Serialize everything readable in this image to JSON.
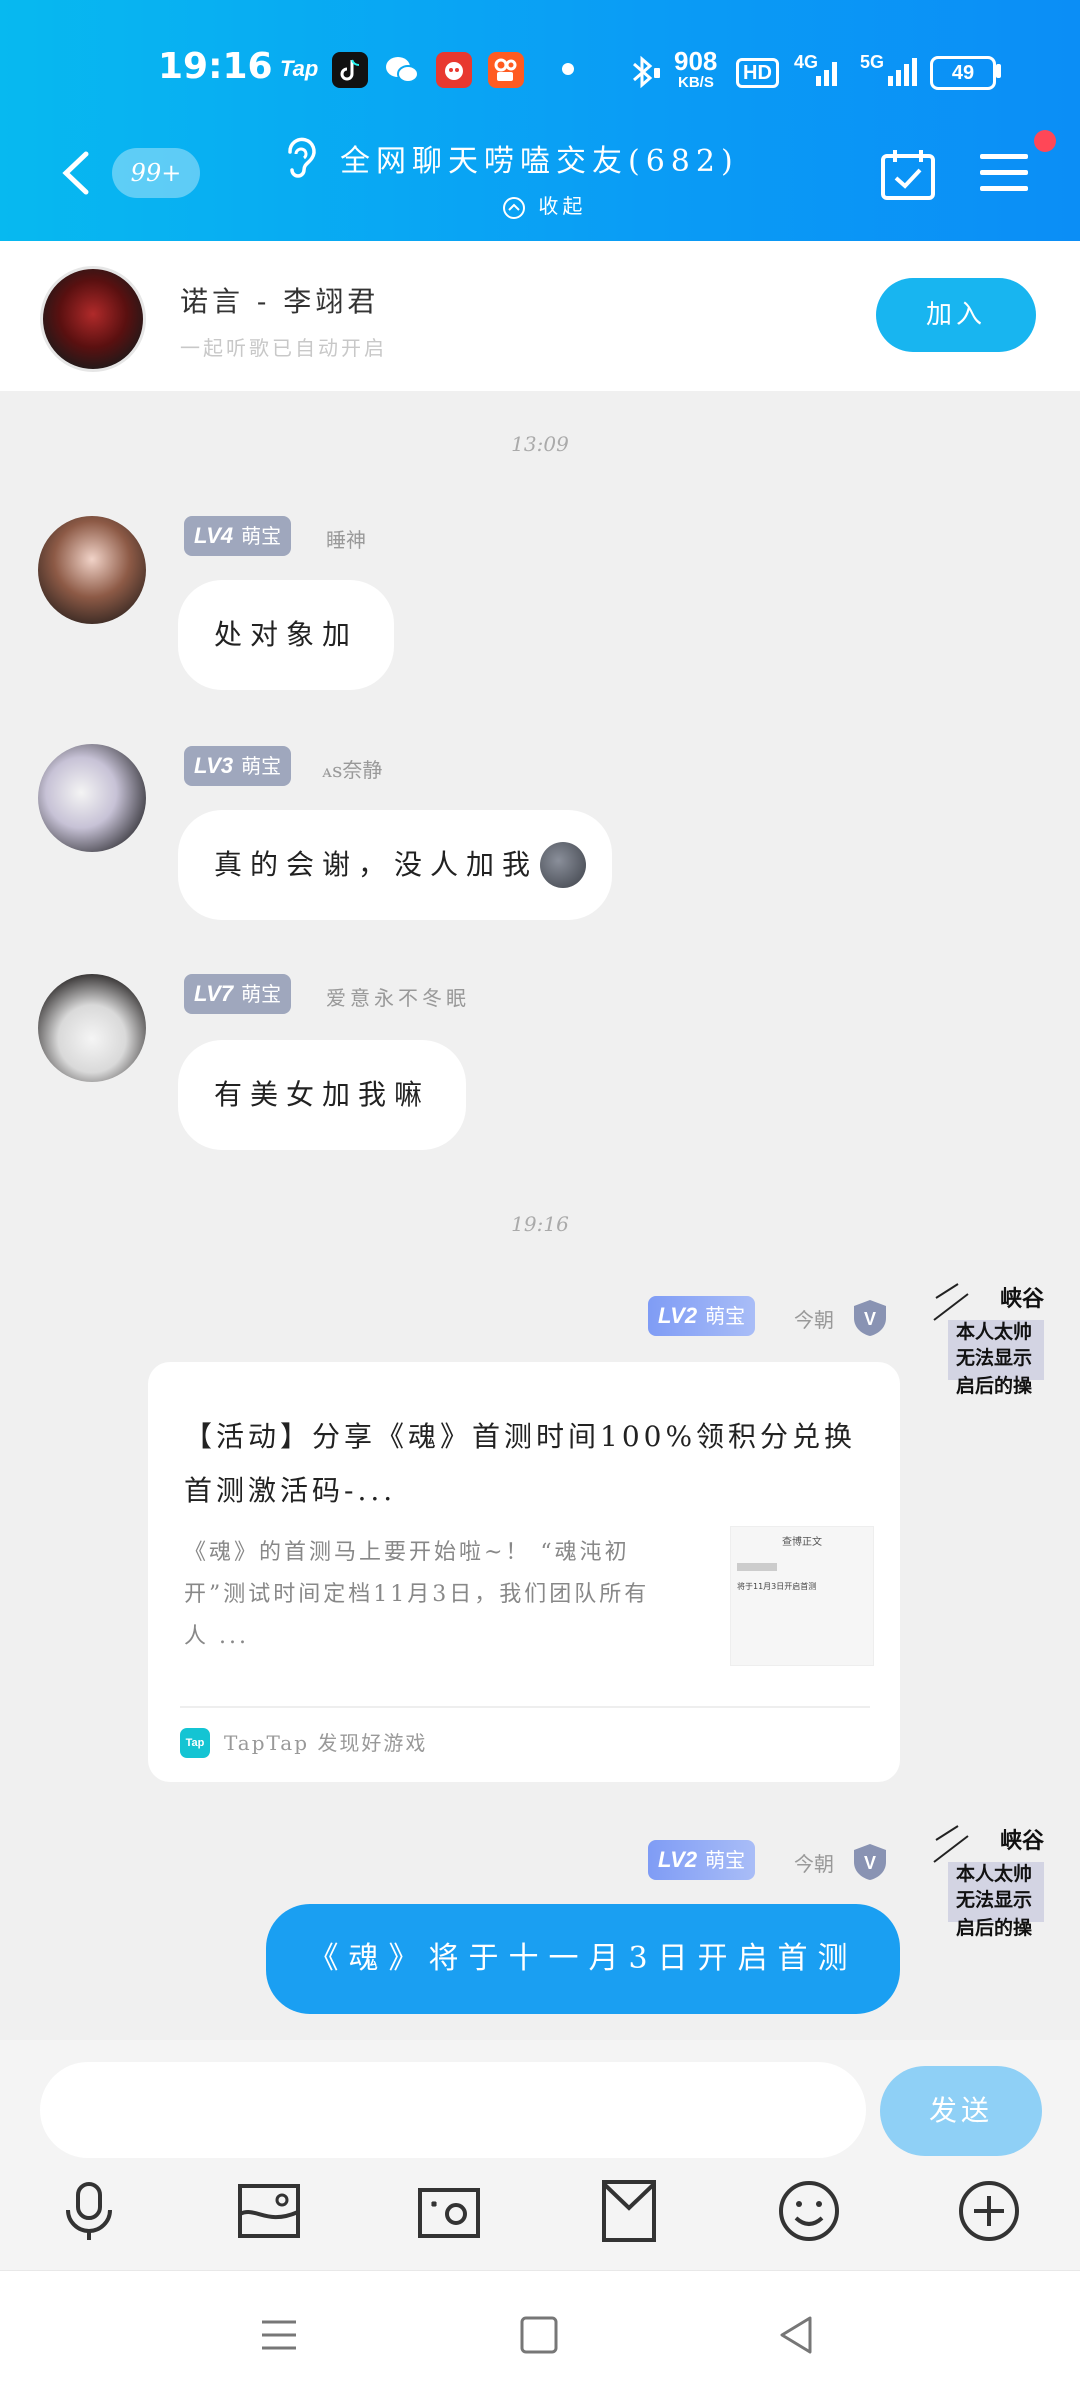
{
  "status_bar": {
    "time": "19:16",
    "tap_label": "Tap",
    "net_speed": "908",
    "net_unit": "KB/S",
    "hd_label": "HD",
    "net1": "4G",
    "net2": "5G",
    "battery": "49"
  },
  "header": {
    "unread_badge": "99+",
    "title": "全网聊天唠嗑交友(682)",
    "collapse_label": "收起"
  },
  "music": {
    "title": "诺言 - 李翊君",
    "subtitle": "一起听歌已自动开启",
    "join_label": "加入"
  },
  "timestamps": [
    "13:09",
    "19:16"
  ],
  "messages": [
    {
      "level": "LV4",
      "rank": "萌宝",
      "nickname": "睡神",
      "text": "处对象加"
    },
    {
      "level": "LV3",
      "rank": "萌宝",
      "nickname": "ꭺs奈静",
      "text": "真的会谢，没人加我"
    },
    {
      "level": "LV7",
      "rank": "萌宝",
      "nickname": "爱意永不冬眠",
      "text": "有美女加我嘛"
    }
  ],
  "self": {
    "level": "LV2",
    "rank": "萌宝",
    "nickname": "今朝",
    "sticker_lines": [
      "峡谷",
      "本人太帅",
      "无法显示",
      "启后的操"
    ]
  },
  "share_card": {
    "title": "【活动】分享《魂》首测时间100%领积分兑换首测激活码-...",
    "description": "《魂》的首测马上要开始啦~！ “魂沌初开”测试时间定档11月3日，我们团队所有人 ...",
    "thumb_title": "查博正文",
    "thumb_line": "将于11月3日开启首测",
    "source": "TapTap 发现好游戏",
    "source_logo": "Tap"
  },
  "my_message": "《魂》将于十一月3日开启首测",
  "input": {
    "placeholder": "",
    "send_label": "发送"
  },
  "colors": {
    "header_start": "#07b9f0",
    "header_end": "#0b8ef6",
    "accent": "#1a9ff2",
    "badge": "#9fa7bd"
  },
  "icons": [
    "back-icon",
    "ear-icon",
    "calendar-check-icon",
    "menu-icon",
    "microphone-icon",
    "image-icon",
    "camera-icon",
    "redpacket-icon",
    "emoji-icon",
    "plus-icon"
  ]
}
